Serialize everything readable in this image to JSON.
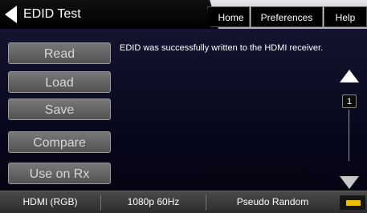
{
  "header": {
    "title": "EDID Test",
    "nav": {
      "home": "Home",
      "preferences": "Preferences",
      "help": "Help"
    }
  },
  "buttons": {
    "read": "Read",
    "load": "Load",
    "save": "Save",
    "compare": "Compare",
    "use_on_rx": "Use on Rx"
  },
  "message": "EDID was successfully written to the HDMI receiver.",
  "pager": {
    "page": "1"
  },
  "status": {
    "signal": "HDMI (RGB)",
    "format": "1080p 60Hz",
    "pattern": "Pseudo Random"
  },
  "colors": {
    "battery": "#e8c200"
  }
}
